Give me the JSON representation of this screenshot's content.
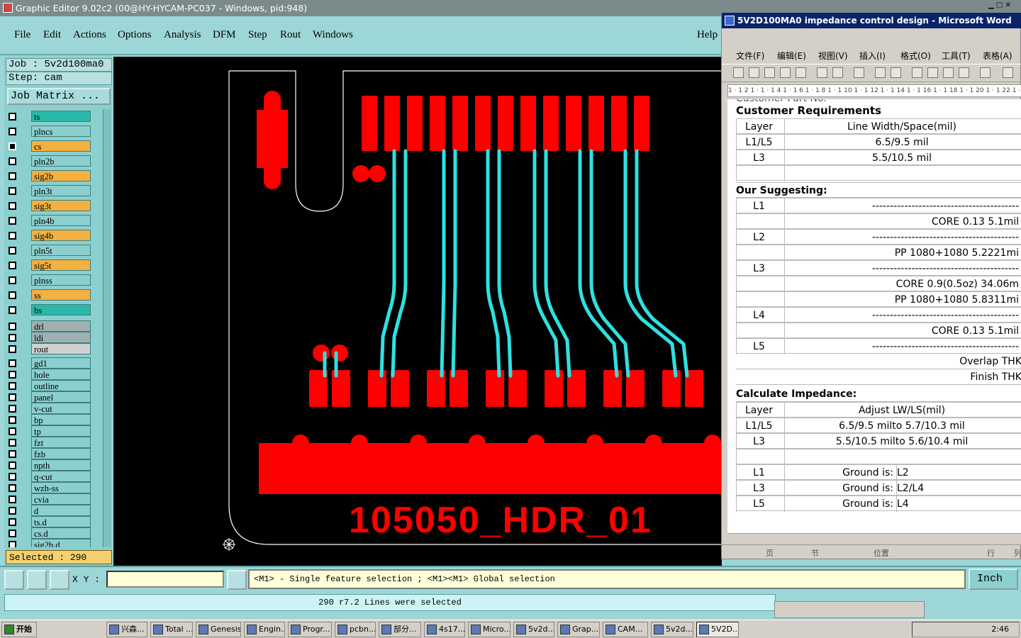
{
  "app_title": "Graphic Editor 9.02c2 (00@HY-HYCAM-PC037 - Windows, pid:948)",
  "menu": [
    "File",
    "Edit",
    "Actions",
    "Options",
    "Analysis",
    "DFM",
    "Step",
    "Rout",
    "Windows",
    "Help"
  ],
  "job_label": "Job  :  5v2d100ma0",
  "step_label": "Step:  cam",
  "job_matrix": "Job Matrix ...",
  "layers": [
    {
      "name": "ts",
      "color": "#2ab8a8"
    },
    {
      "name": "plncs",
      "color": "#8ccfcf"
    },
    {
      "name": "cs",
      "color": "#f4b040"
    },
    {
      "name": "pln2b",
      "color": "#8ccfcf"
    },
    {
      "name": "sig2b",
      "color": "#f4b040"
    },
    {
      "name": "pln3t",
      "color": "#8ccfcf"
    },
    {
      "name": "sig3t",
      "color": "#f4b040"
    },
    {
      "name": "pln4b",
      "color": "#8ccfcf"
    },
    {
      "name": "sig4b",
      "color": "#f4b040"
    },
    {
      "name": "pln5t",
      "color": "#8ccfcf"
    },
    {
      "name": "sig5t",
      "color": "#f4b040"
    },
    {
      "name": "plnss",
      "color": "#8ccfcf"
    },
    {
      "name": "ss",
      "color": "#f4b040"
    },
    {
      "name": "bs",
      "color": "#2ab8a8"
    },
    {
      "name": "drl",
      "color": "#a0b0b0"
    },
    {
      "name": "ldi",
      "color": "#a0b0b0"
    },
    {
      "name": "rout",
      "color": "#d0d0d0"
    },
    {
      "name": "gd1",
      "color": "#8ccfcf"
    },
    {
      "name": "hole",
      "color": "#8ccfcf"
    },
    {
      "name": "outline",
      "color": "#8ccfcf"
    },
    {
      "name": "panel",
      "color": "#8ccfcf"
    },
    {
      "name": "v-cut",
      "color": "#8ccfcf"
    },
    {
      "name": "bp",
      "color": "#8ccfcf"
    },
    {
      "name": "tp",
      "color": "#8ccfcf"
    },
    {
      "name": "fzt",
      "color": "#8ccfcf"
    },
    {
      "name": "fzb",
      "color": "#8ccfcf"
    },
    {
      "name": "npth",
      "color": "#8ccfcf"
    },
    {
      "name": "q-cut",
      "color": "#8ccfcf"
    },
    {
      "name": "wzh-ss",
      "color": "#8ccfcf"
    },
    {
      "name": "cvia",
      "color": "#8ccfcf"
    },
    {
      "name": "d",
      "color": "#8ccfcf"
    },
    {
      "name": "ts.d",
      "color": "#8ccfcf"
    },
    {
      "name": "cs.d",
      "color": "#8ccfcf"
    },
    {
      "name": "sig2b.d",
      "color": "#8ccfcf"
    }
  ],
  "selected_label": "Selected : 290",
  "board_text": "105050_HDR_01",
  "xy_label": "X Y :",
  "hint": "<M1> - Single feature selection ; <M1><M1> Global selection",
  "unit_button": "Inch",
  "status": "290 r7.2 Lines were selected",
  "word": {
    "title": "5V2D100MA0 impedance control design - Microsoft Word",
    "menu": [
      "文件(F)",
      "编辑(E)",
      "视图(V)",
      "插入(I)",
      "格式(O)",
      "工具(T)",
      "表格(A)"
    ],
    "ruler": "1 · 1 2 1 · 1 · 1 4 1 · 1 6 1 · 1 8 1 · 1 10 1 · 1 12 1 · 1 14 1 · 1 16 1 · 1 18 1 · 1 20 1 · 1 22 1 · 1 24 1",
    "partial_top": "Customer Part No.",
    "cust_req": "Customer Requirements",
    "req_header": [
      "Layer",
      "Line Width/Space(mil)"
    ],
    "req_rows": [
      [
        "L1/L5",
        "6.5/9.5 mil"
      ],
      [
        "L3",
        "5.5/10.5 mil"
      ],
      [
        "",
        ""
      ]
    ],
    "suggest": "Our Suggesting:",
    "stack_rows": [
      [
        "L1",
        "-----------------------------------------"
      ],
      [
        "",
        "CORE  0.13  5.1mil"
      ],
      [
        "L2",
        "-----------------------------------------"
      ],
      [
        "",
        "PP  1080+1080  5.2221mi"
      ],
      [
        "L3",
        "-----------------------------------------"
      ],
      [
        "",
        "CORE  0.9(0.5oz)  34.06m"
      ],
      [
        "",
        "PP  1080+1080  5.8311mi"
      ],
      [
        "L4",
        "-----------------------------------------"
      ],
      [
        "",
        "CORE  0.13  5.1mil"
      ],
      [
        "L5",
        "-----------------------------------------"
      ]
    ],
    "overlap": "Overlap THK",
    "finish": "Finish THK",
    "calc": "Calculate Impedance:",
    "imp_header": [
      "Layer",
      "Adjust LW/LS(mil)"
    ],
    "imp_rows": [
      [
        "L1/L5",
        "6.5/9.5 milto  5.7/10.3 mil"
      ],
      [
        "L3",
        "5.5/10.5 milto  5.6/10.4 mil"
      ],
      [
        "",
        ""
      ]
    ],
    "ground_rows": [
      [
        "L1",
        "Ground is:",
        "L2"
      ],
      [
        "L3",
        "Ground is:",
        "L2/L4"
      ],
      [
        "L5",
        "Ground is:",
        "L4"
      ]
    ],
    "status": [
      "页",
      "节",
      "位置",
      "行",
      "列"
    ]
  },
  "taskbar": {
    "start": "开始",
    "tasks": [
      "兴森...",
      "Total ...",
      "Genesis",
      "Engin...",
      "Progr...",
      "pcbn...",
      "部分...",
      "4s17...",
      "Micro...",
      "5v2d...",
      "Grap...",
      "CAM...",
      "5v2d...",
      "5V2D..."
    ],
    "clock": "2:46"
  }
}
